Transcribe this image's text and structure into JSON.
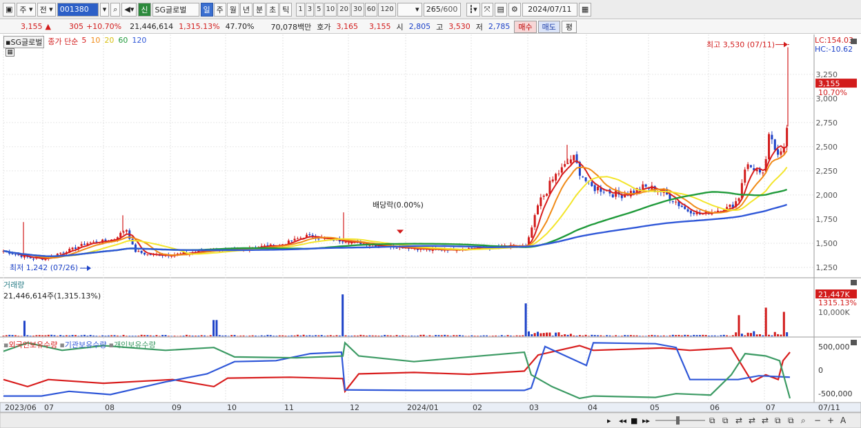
{
  "toolbar": {
    "market_label": "주",
    "mode_label": "전",
    "code_value": "001380",
    "market_badge": "신",
    "stock_name": "SG글로벌",
    "periods": [
      "일",
      "주",
      "월",
      "년",
      "분",
      "초",
      "틱"
    ],
    "selected_period": "일",
    "intervals": [
      "1",
      "3",
      "5",
      "10",
      "20",
      "30",
      "60",
      "120"
    ],
    "count_value": "265",
    "count_total": "/600",
    "date_value": "2024/07/11"
  },
  "quote": {
    "price": "3,155",
    "change": "305",
    "change_pct": "+10.70%",
    "volume": "21,446,614",
    "vol_ratio": "1,315.13%",
    "turnover": "47.70%",
    "amount": "70,078백만",
    "bid_label": "호가",
    "ask_price": "3,165",
    "bid_price": "3,155",
    "open_label": "시",
    "open": "2,805",
    "high_label": "고",
    "high": "3,530",
    "low_label": "저",
    "low": "2,785",
    "buy_label": "매수",
    "sell_label": "매도",
    "flat_label": "평"
  },
  "price_panel": {
    "name_tag": "SG글로벌",
    "ma_label": "종가 단순",
    "ma_periods": [
      "5",
      "10",
      "20",
      "60",
      "120"
    ],
    "lc": "LC:154.03",
    "hc": "HC:-10.62",
    "current_price": "3,155",
    "current_pct": "10.70%",
    "high_annotation": "최고 3,530 (07/11)",
    "low_annotation": "최저 1,242 (07/26)",
    "dividend_annotation": "배당락(0.00%)",
    "yticks": [
      "3,250",
      "3,000",
      "2,750",
      "2,500",
      "2,250",
      "2,000",
      "1,750",
      "1,500",
      "1,250"
    ]
  },
  "volume_panel": {
    "title": "거래량",
    "value": "21,446,614주(1,315.13%)",
    "tag": "21,447K",
    "tag_pct": "1315.13%",
    "ytick": "10,000K"
  },
  "holdings_panel": {
    "series_labels": [
      "외국인보유수량",
      "기관보유수량",
      "개인보유수량"
    ],
    "yticks": [
      "500,000",
      "0",
      "-500,000"
    ]
  },
  "xaxis": {
    "labels": [
      "2023/06",
      "07",
      "08",
      "09",
      "10",
      "11",
      "12",
      "2024/01",
      "02",
      "03",
      "04",
      "05",
      "06",
      "07"
    ],
    "right_label": "07/11"
  },
  "colors": {
    "up": "#d21b1b",
    "down": "#1d42c8",
    "ma5": "#d81d1d",
    "ma10": "#f08a16",
    "ma20": "#f3e52a",
    "ma60": "#1f9a3a",
    "ma120": "#2f57d8",
    "foreign": "#d81d1d",
    "institution": "#2f57d8",
    "individual": "#3b9a63"
  }
}
